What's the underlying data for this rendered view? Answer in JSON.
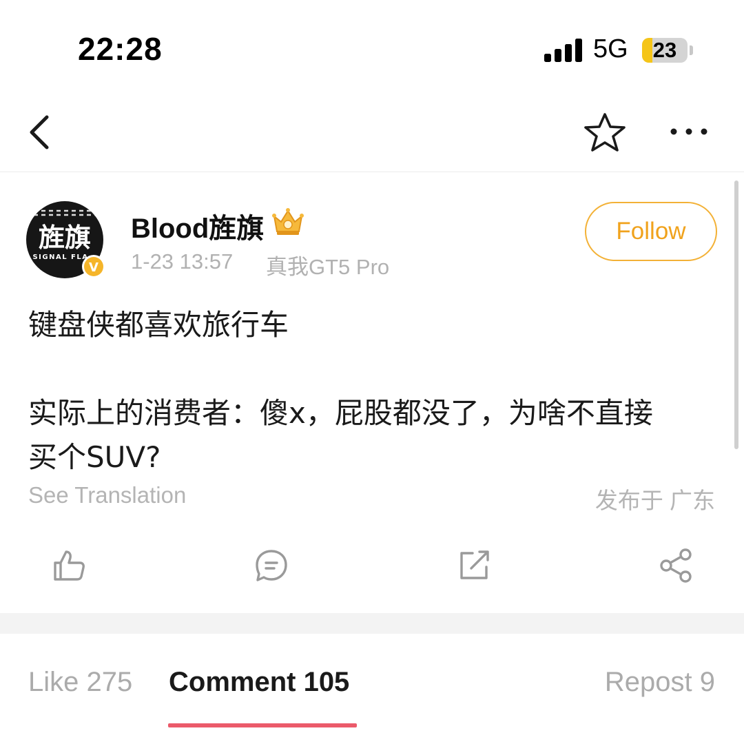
{
  "status_bar": {
    "time": "22:28",
    "network": "5G",
    "battery": "23",
    "battery_level": 0.23,
    "battery_color": "#f5c518"
  },
  "nav": {
    "back_icon": "chevron-left-icon",
    "favorite_icon": "star-icon",
    "more_icon": "more-icon"
  },
  "post": {
    "author": "Blood旌旗",
    "avatar_text": "旌旗",
    "avatar_subtext": "SIGNAL FLA",
    "verified_badge": "V",
    "badge_icon": "crown-icon",
    "time": "1-23 13:57",
    "device": "真我GT5 Pro",
    "follow_label": "Follow",
    "content_line1": "键盘侠都喜欢旅行车",
    "content_line2": "实际上的消费者：傻x，屁股都没了，为啥不直接",
    "content_line3": "买个SUV?",
    "see_translation": "See Translation",
    "location": "发布于 广东"
  },
  "actions": [
    "like-icon",
    "comment-icon",
    "repost-icon",
    "share-icon"
  ],
  "tabs": {
    "like": "Like 275",
    "comment": "Comment 105",
    "repost": "Repost 9",
    "active": "comment"
  },
  "colors": {
    "accent": "#f0a21c",
    "tab_underline": "#eb5a6a",
    "muted_text": "#b1b1b1"
  }
}
